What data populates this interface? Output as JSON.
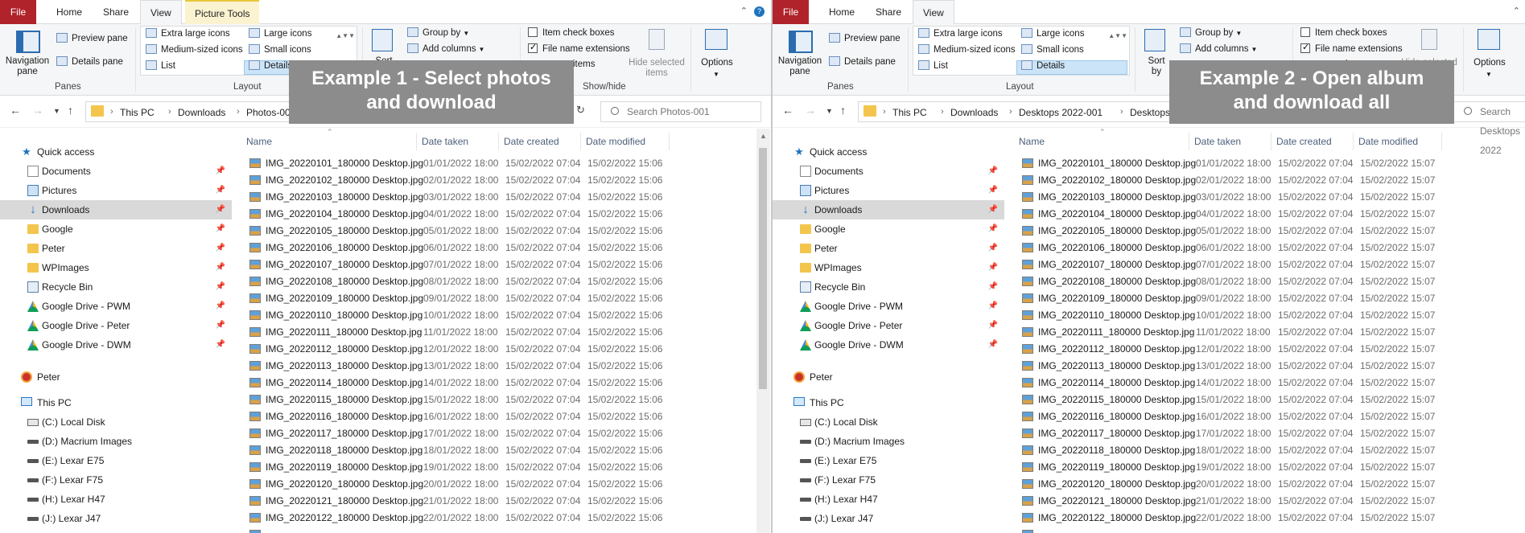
{
  "overlays": [
    {
      "line1": "Example 1 - Select photos",
      "line2": "and download"
    },
    {
      "line1": "Example 2 - Open album",
      "line2": "and download all"
    }
  ],
  "ribbon": {
    "tabs": {
      "file": "File",
      "home": "Home",
      "share": "Share",
      "view": "View",
      "picture_tools": "Picture Tools"
    },
    "navigation_pane": "Navigation pane",
    "preview_pane": "Preview pane",
    "details_pane": "Details pane",
    "panes_group": "Panes",
    "layout": {
      "extra_large": "Extra large icons",
      "large": "Large icons",
      "medium": "Medium-sized icons",
      "small": "Small icons",
      "list": "List",
      "details": "Details"
    },
    "layout_group": "Layout",
    "sort_by": "Sort by",
    "group_by": "Group by",
    "add_columns": "Add columns",
    "item_check_boxes": "Item check boxes",
    "file_name_extensions": "File name extensions",
    "hidden_items": "items",
    "hide_selected": "Hide selected items",
    "show_hide_group": "Show/hide",
    "options": "Options"
  },
  "win1": {
    "crumbs": [
      "This PC",
      "Downloads",
      "Photos-001"
    ],
    "search_placeholder": "Search Photos-001",
    "modified_time": "15:06"
  },
  "win2": {
    "crumbs": [
      "This PC",
      "Downloads",
      "Desktops 2022-001",
      "Desktops 2022"
    ],
    "search_placeholder": "Search Desktops 2022",
    "modified_time": "15:07"
  },
  "columns": {
    "name": "Name",
    "date_taken": "Date taken",
    "date_created": "Date created",
    "date_modified": "Date modified"
  },
  "nav": {
    "quick_access": "Quick access",
    "items": [
      "Documents",
      "Pictures",
      "Downloads",
      "Google",
      "Peter",
      "WPImages",
      "Recycle Bin",
      "Google Drive - PWM",
      "Google Drive - Peter",
      "Google Drive - DWM"
    ],
    "user": "Peter",
    "this_pc": "This PC",
    "drives": [
      "(C:) Local Disk",
      "(D:) Macrium Images",
      "(E:) Lexar E75",
      "(F:) Lexar F75",
      "(H:) Lexar H47",
      "(J:) Lexar J47"
    ]
  },
  "files": [
    {
      "name": "IMG_20220101_180000 Desktop.jpg",
      "taken": "01/01/2022 18:00",
      "created": "15/02/2022 07:04"
    },
    {
      "name": "IMG_20220102_180000 Desktop.jpg",
      "taken": "02/01/2022 18:00",
      "created": "15/02/2022 07:04"
    },
    {
      "name": "IMG_20220103_180000 Desktop.jpg",
      "taken": "03/01/2022 18:00",
      "created": "15/02/2022 07:04"
    },
    {
      "name": "IMG_20220104_180000 Desktop.jpg",
      "taken": "04/01/2022 18:00",
      "created": "15/02/2022 07:04"
    },
    {
      "name": "IMG_20220105_180000 Desktop.jpg",
      "taken": "05/01/2022 18:00",
      "created": "15/02/2022 07:04"
    },
    {
      "name": "IMG_20220106_180000 Desktop.jpg",
      "taken": "06/01/2022 18:00",
      "created": "15/02/2022 07:04"
    },
    {
      "name": "IMG_20220107_180000 Desktop.jpg",
      "taken": "07/01/2022 18:00",
      "created": "15/02/2022 07:04"
    },
    {
      "name": "IMG_20220108_180000 Desktop.jpg",
      "taken": "08/01/2022 18:00",
      "created": "15/02/2022 07:04"
    },
    {
      "name": "IMG_20220109_180000 Desktop.jpg",
      "taken": "09/01/2022 18:00",
      "created": "15/02/2022 07:04"
    },
    {
      "name": "IMG_20220110_180000 Desktop.jpg",
      "taken": "10/01/2022 18:00",
      "created": "15/02/2022 07:04"
    },
    {
      "name": "IMG_20220111_180000 Desktop.jpg",
      "taken": "11/01/2022 18:00",
      "created": "15/02/2022 07:04"
    },
    {
      "name": "IMG_20220112_180000 Desktop.jpg",
      "taken": "12/01/2022 18:00",
      "created": "15/02/2022 07:04"
    },
    {
      "name": "IMG_20220113_180000 Desktop.jpg",
      "taken": "13/01/2022 18:00",
      "created": "15/02/2022 07:04"
    },
    {
      "name": "IMG_20220114_180000 Desktop.jpg",
      "taken": "14/01/2022 18:00",
      "created": "15/02/2022 07:04"
    },
    {
      "name": "IMG_20220115_180000 Desktop.jpg",
      "taken": "15/01/2022 18:00",
      "created": "15/02/2022 07:04"
    },
    {
      "name": "IMG_20220116_180000 Desktop.jpg",
      "taken": "16/01/2022 18:00",
      "created": "15/02/2022 07:04"
    },
    {
      "name": "IMG_20220117_180000 Desktop.jpg",
      "taken": "17/01/2022 18:00",
      "created": "15/02/2022 07:04"
    },
    {
      "name": "IMG_20220118_180000 Desktop.jpg",
      "taken": "18/01/2022 18:00",
      "created": "15/02/2022 07:04"
    },
    {
      "name": "IMG_20220119_180000 Desktop.jpg",
      "taken": "19/01/2022 18:00",
      "created": "15/02/2022 07:04"
    },
    {
      "name": "IMG_20220120_180000 Desktop.jpg",
      "taken": "20/01/2022 18:00",
      "created": "15/02/2022 07:04"
    },
    {
      "name": "IMG_20220121_180000 Desktop.jpg",
      "taken": "21/01/2022 18:00",
      "created": "15/02/2022 07:04"
    },
    {
      "name": "IMG_20220122_180000 Desktop.jpg",
      "taken": "22/01/2022 18:00",
      "created": "15/02/2022 07:04"
    }
  ],
  "modified_date": "15/02/2022"
}
